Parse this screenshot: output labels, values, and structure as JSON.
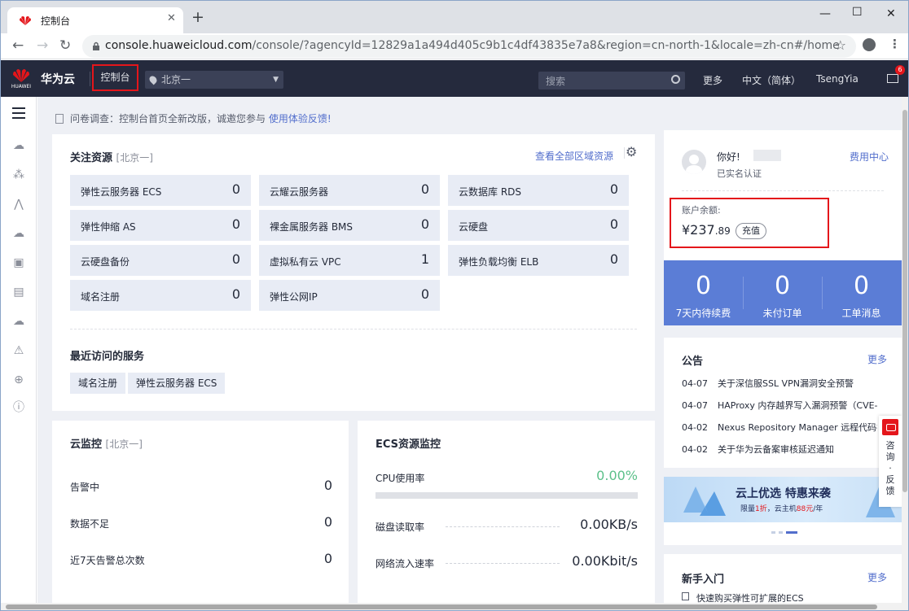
{
  "browser": {
    "tab_title": "控制台",
    "url_host": "console.huaweicloud.com",
    "url_rest": "/console/?agencyId=12829a1a494d405c9b1c4df43835e7a8&region=cn-north-1&locale=zh-cn#/home"
  },
  "header": {
    "logo_text": "HUAWEI",
    "brand": "华为云",
    "console": "控制台",
    "region": "北京一",
    "search_placeholder": "搜索",
    "more": "更多",
    "language": "中文（简体）",
    "user": "TsengYia",
    "mail_badge": "6"
  },
  "notice": {
    "text": "问卷调查：控制台首页全新改版，诚邀您参与",
    "link": "使用体验反馈!"
  },
  "resources": {
    "title": "关注资源",
    "region": "[北京一]",
    "view_all": "查看全部区域资源",
    "tiles": [
      {
        "name": "弹性云服务器 ECS",
        "value": "0"
      },
      {
        "name": "云耀云服务器",
        "value": "0"
      },
      {
        "name": "云数据库 RDS",
        "value": "0"
      },
      {
        "name": "弹性伸缩 AS",
        "value": "0"
      },
      {
        "name": "裸金属服务器 BMS",
        "value": "0"
      },
      {
        "name": "云硬盘",
        "value": "0"
      },
      {
        "name": "云硬盘备份",
        "value": "0"
      },
      {
        "name": "虚拟私有云 VPC",
        "value": "1"
      },
      {
        "name": "弹性负载均衡 ELB",
        "value": "0"
      },
      {
        "name": "域名注册",
        "value": "0"
      },
      {
        "name": "弹性公网IP",
        "value": "0"
      }
    ],
    "recent_title": "最近访问的服务",
    "recent": [
      "域名注册",
      "弹性云服务器 ECS"
    ]
  },
  "cloud_monitor": {
    "title": "云监控",
    "region": "[北京一]",
    "rows": [
      {
        "label": "告警中",
        "value": "0"
      },
      {
        "label": "数据不足",
        "value": "0"
      },
      {
        "label": "近7天告警总次数",
        "value": "0"
      }
    ]
  },
  "ecs_monitor": {
    "title": "ECS资源监控",
    "cpu_label": "CPU使用率",
    "cpu_value": "0.00%",
    "cpu_fraction": 0,
    "disk_label": "磁盘读取率",
    "disk_value": "0.00KB/s",
    "net_label": "网络流入速率",
    "net_value": "0.00Kbit/s"
  },
  "account": {
    "greeting": "你好!",
    "verified": "已实名认证",
    "billing": "费用中心",
    "balance_label": "账户余额:",
    "balance_main": "¥237",
    "balance_cents": ".89",
    "recharge": "充值"
  },
  "stats": [
    {
      "num": "0",
      "label": "7天内待续费"
    },
    {
      "num": "0",
      "label": "未付订单"
    },
    {
      "num": "0",
      "label": "工单消息"
    }
  ],
  "announcements": {
    "title": "公告",
    "more": "更多",
    "items": [
      {
        "date": "04-07",
        "text": "关于深信服SSL VPN漏洞安全预警"
      },
      {
        "date": "04-07",
        "text": "HAProxy 内存越界写入漏洞预警（CVE-20..."
      },
      {
        "date": "04-02",
        "text": "Nexus Repository Manager 远程代码执行..."
      },
      {
        "date": "04-02",
        "text": "关于华为云备案审核延迟通知"
      }
    ]
  },
  "banner": {
    "headline": "云上优选 特惠来袭",
    "sub_prefix": "限量",
    "sub_hl1": "1折",
    "sub_mid": "，云主机",
    "sub_hl2": "88元",
    "sub_suffix": "/年"
  },
  "getting_started": {
    "title": "新手入门",
    "more": "更多",
    "first_item": "快速购买弹性可扩展的ECS"
  },
  "float_widget": {
    "text": "咨询·反馈"
  },
  "colors": {
    "header_bg": "#252a3d",
    "accent_red": "#e4161b",
    "link_blue": "#526ecc",
    "stats_bg": "#5b7dd6",
    "cpu_green": "#5cc08a"
  }
}
